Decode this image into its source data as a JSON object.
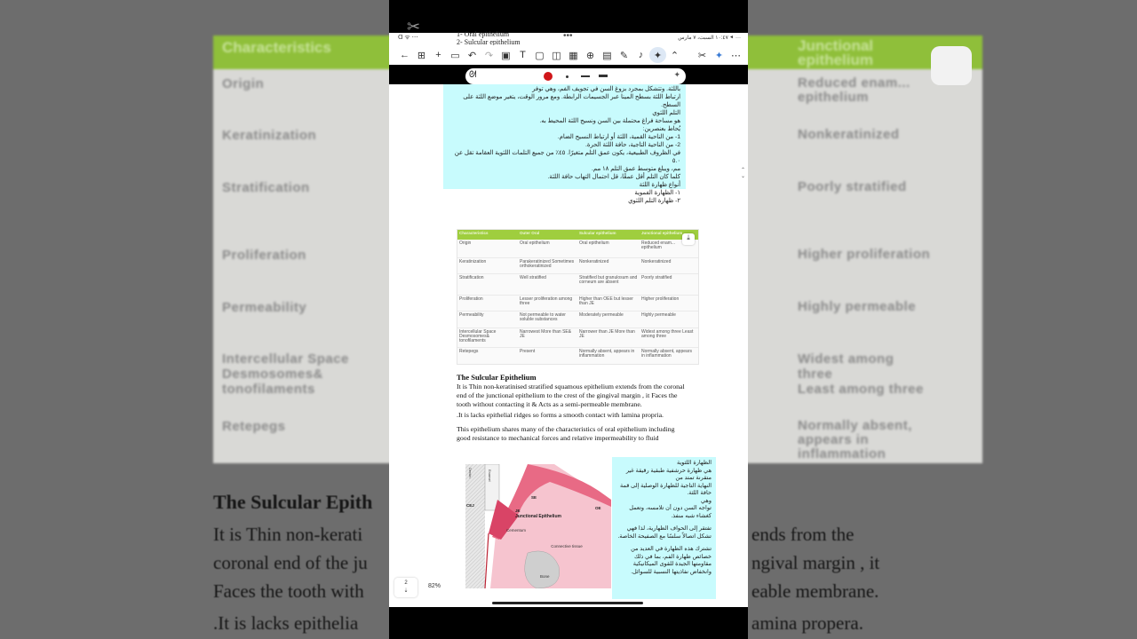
{
  "background": {
    "table_headers": [
      "Characteristics",
      "Outer Oral",
      "Sulcular epithelium",
      "Junctional epithelium"
    ],
    "row_labels": [
      "Origin",
      "Keratinization",
      "Stratification",
      "Proliferation",
      "Permeability",
      "Intercellular Space\nDesmosomes&\ntonofilaments",
      "Retepegs"
    ],
    "right_values": [
      "Reduced enam...\nepithelium",
      "Nonkeratinized",
      "Poorly stratified",
      "Higher proliferation",
      "Highly permeable",
      "Widest among\nthree\nLeast among three",
      "Normally absent,\nappears in\ninflammation"
    ],
    "heading": "The Sulcular Epith",
    "lines": [
      "It is Thin non-kerati",
      "coronal end of the ju",
      "Faces the tooth with",
      ".It is lacks epithelia"
    ],
    "right_lines": [
      "ends from the",
      "ngival margin , it",
      "eable membrane.",
      "amina propera."
    ]
  },
  "status_bar": {
    "left": "ᗡ ᯤ ⋯",
    "right": "١٠:٤٧ السبت، ٧ مارس ⯇ ···"
  },
  "page_header": [
    "1- Oral epithelium",
    "2- Sulcular epithelium",
    "3- J"
  ],
  "toolbar": {
    "icons": [
      "back-icon",
      "grid-icon",
      "add-icon",
      "lock-icon",
      "undo-icon",
      "redo-icon",
      "image-icon",
      "text-icon",
      "sticky-note-icon",
      "note-icon",
      "table-icon",
      "zoom-icon",
      "scan-icon",
      "pen-icon",
      "mic-icon",
      "highlighter-icon",
      "chevron-up-icon"
    ],
    "right_icons": [
      "no-pen-icon",
      "ai-sparkle-icon",
      "more-icon"
    ]
  },
  "arabic_top": [
    "باللثة. وتتشكل بمجرد بزوغ السن في تجويف الفم، وهي توفر",
    "ارتباط اللثة بسطح المينا عبر الجسيمات الرابطة. ومع مرور الوقت، يتغير موضع اللثة على السطح.",
    "التلم اللثوي",
    "هو مساحة فراغ محتملة بين السن ونسيج اللثة المحيط به.",
    "يُحاط بعنصرين:",
    "1- من الناحية القمية، اللثة أو ارتباط النسيج الضام.",
    "2- من الناحية التاجية، حافة اللثة الحرة.",
    "في الظروف الطبيعية، يكون عمق التلم متغيرًا. ٤٥٪ من جميع التلمات اللثوية العقامة تقل عن ٥.٠",
    "مم، ويبلغ متوسط عمق التلم ١٨ مم.",
    "كلما كان التلم أقل عمقًا، قل احتمال التهاب حافة اللثة.",
    "أنواع ظهارة اللثة",
    "١- الظهارة الفموية",
    "٢- ظهارة التلم اللثوي"
  ],
  "table": {
    "headers": [
      "Characteristics",
      "Outer Oral",
      "Sulcular epithelium",
      "Junctional epithelium"
    ],
    "rows": [
      [
        "Origin",
        "Oral epithelium",
        "Oral epithelium",
        "Reduced enam... epithelium"
      ],
      [
        "Keratinization",
        "Parakeratinized Sometimes orthokeratinized",
        "Nonkeratinized",
        "Nonkeratinized"
      ],
      [
        "Stratification",
        "Well stratified",
        "Stratified but granulosum and corneum are absent",
        "Poorly stratified"
      ],
      [
        "Proliferation",
        "Lesser proliferation among three",
        "Higher than OEE but lesser than JE",
        "Higher proliferation"
      ],
      [
        "Permeability",
        "Not permeable to water soluble substances",
        "Moderately permeable",
        "Highly permeable"
      ],
      [
        "Intercellular Space Desmosomes& tonofilaments",
        "Narrowest More than SE& JE",
        "Narrower than JE More than JE",
        "Widest among three Least among three"
      ],
      [
        "Retepegs",
        "Present",
        "Normally absent, appears in inflammation",
        "Normally absent, appears in inflammation"
      ]
    ]
  },
  "sulcular": {
    "heading": "The Sulcular Epithelium",
    "para1": "It is Thin non-keratinised stratified squamous epithelium  extends from the coronal end of the junctional epithelium to the crest of the gingival margin , it Faces the tooth without contacting it & Acts as a semi-permeable membrane.",
    "para2": ".It is lacks epithelial ridges so forms a smooth contact with lamina propria.",
    "para3": "This epithelium shares many of the characteristics of oral epithelium including good resistance to mechanical forces and relative impermeability to fluid"
  },
  "diagram": {
    "labels": [
      "Dentin",
      "Enamel",
      "CEJ",
      "SE",
      "JE",
      "OE",
      "Junctional Epithelium",
      "Cementum",
      "Connective tissue",
      "Bone"
    ]
  },
  "arabic_side": [
    "الظهارة اللثوية",
    "هي ظهارة حرشفية طبقية رقيقة غير متقرنة تمتد من",
    "النهاية التاجية للظهارة الوصلية إلى قمة حافة اللثة.",
    "وهي",
    "تواجه السن دون أن تلامسه، وتعمل كغشاء شبه منفذ.",
    "تفتقر إلى الحواف الظهارية، لذا فهي تشكل اتصالاً سلسًا مع الصفيحة الخاصة.",
    "تشترك هذه الظهارة في العديد من خصائص ظهارة الفم، بما في ذلك مقاومتها الجيدة للقوى الميكانيكية وانخفاض نفاذيتها النسبية للسوائل."
  ],
  "page_indicator": {
    "current": "2",
    "arrow": "⇣"
  },
  "zoom": "82%"
}
